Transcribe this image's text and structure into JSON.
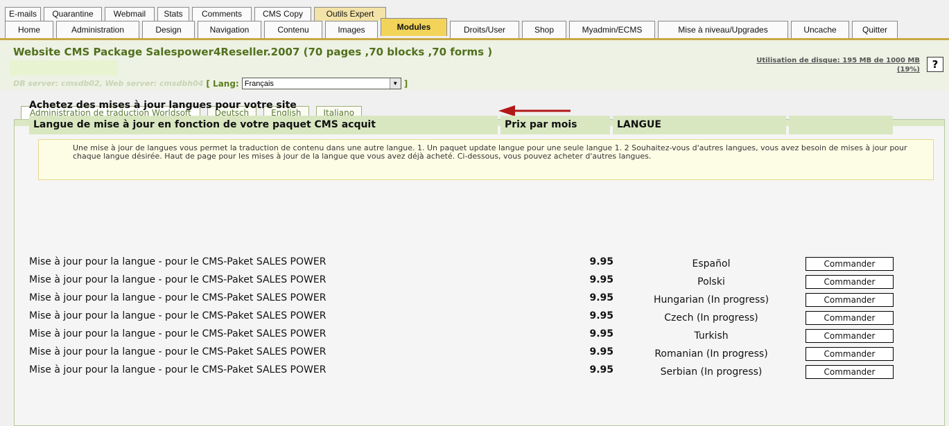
{
  "top_tabs_row1": [
    {
      "label": "E-mails",
      "w": 52
    },
    {
      "label": "Quarantine",
      "w": 84
    },
    {
      "label": "Webmail",
      "w": 72
    },
    {
      "label": "Stats",
      "w": 46
    },
    {
      "label": "Comments",
      "w": 86
    },
    {
      "label": "CMS Copy",
      "w": 82
    },
    {
      "label": "Outils Expert",
      "w": 104
    }
  ],
  "top_tabs_row2": [
    "Home",
    "Administration",
    "Design",
    "Navigation",
    "Contenu",
    "Images",
    "Modules",
    "Droits/User",
    "Shop",
    "Myadmin/ECMS",
    "Mise à niveau/Upgrades",
    "Uncache",
    "Quitter"
  ],
  "header": {
    "title": "Website CMS Package Salespower4Reseller.2007 (70 pages ,70 blocks ,70 forms )",
    "server_info": "DB server: cmsdb02, Web server: cmsdbh04",
    "lang_label": "[ Lang:",
    "lang_selected": "Français",
    "lang_close": "]",
    "disk_line1": "Utilisation de disque: 195 MB de 1000 MB",
    "disk_line2": "(19%)",
    "help": "?"
  },
  "lang_tabs": [
    "Administration de traduction Worldsoft",
    "Deutsch",
    "English",
    "Italiano"
  ],
  "notice": "Une mise à jour de langues vous permet la traduction de contenu dans une autre langue. 1. Un paquet update langue pour une seule langue 1. 2 Souhaitez-vous d'autres langues, vous avez besoin de mises à jour pour chaque langue désirée. Haut de page pour les mises à jour de la langue que vous avez déjà acheté. Ci-dessous, vous pouvez acheter d'autres langues.",
  "table": {
    "title": "Achetez des mises à jour langues pour votre site",
    "headers": [
      "Langue de mise à jour en fonction de votre paquet CMS acquit",
      "Prix par mois",
      "LANGUE",
      ""
    ],
    "rows": [
      {
        "desc": "Mise à jour pour la langue - pour le CMS-Paket SALES POWER",
        "price": "9.95",
        "lang": "Español",
        "action": "Commander"
      },
      {
        "desc": "Mise à jour pour la langue - pour le CMS-Paket SALES POWER",
        "price": "9.95",
        "lang": "Polski",
        "action": "Commander"
      },
      {
        "desc": "Mise à jour pour la langue - pour le CMS-Paket SALES POWER",
        "price": "9.95",
        "lang": "Hungarian (In progress)",
        "action": "Commander"
      },
      {
        "desc": "Mise à jour pour la langue - pour le CMS-Paket SALES POWER",
        "price": "9.95",
        "lang": "Czech (In progress)",
        "action": "Commander"
      },
      {
        "desc": "Mise à jour pour la langue - pour le CMS-Paket SALES POWER",
        "price": "9.95",
        "lang": "Turkish",
        "action": "Commander"
      },
      {
        "desc": "Mise à jour pour la langue - pour le CMS-Paket SALES POWER",
        "price": "9.95",
        "lang": "Romanian (In progress)",
        "action": "Commander"
      },
      {
        "desc": "Mise à jour pour la langue - pour le CMS-Paket SALES POWER",
        "price": "9.95",
        "lang": "Serbian (In progress)",
        "action": "Commander"
      }
    ]
  },
  "colors": {
    "accent_green": "#51701d",
    "active_tab": "#f3d45a",
    "arrow": "#b21818"
  }
}
